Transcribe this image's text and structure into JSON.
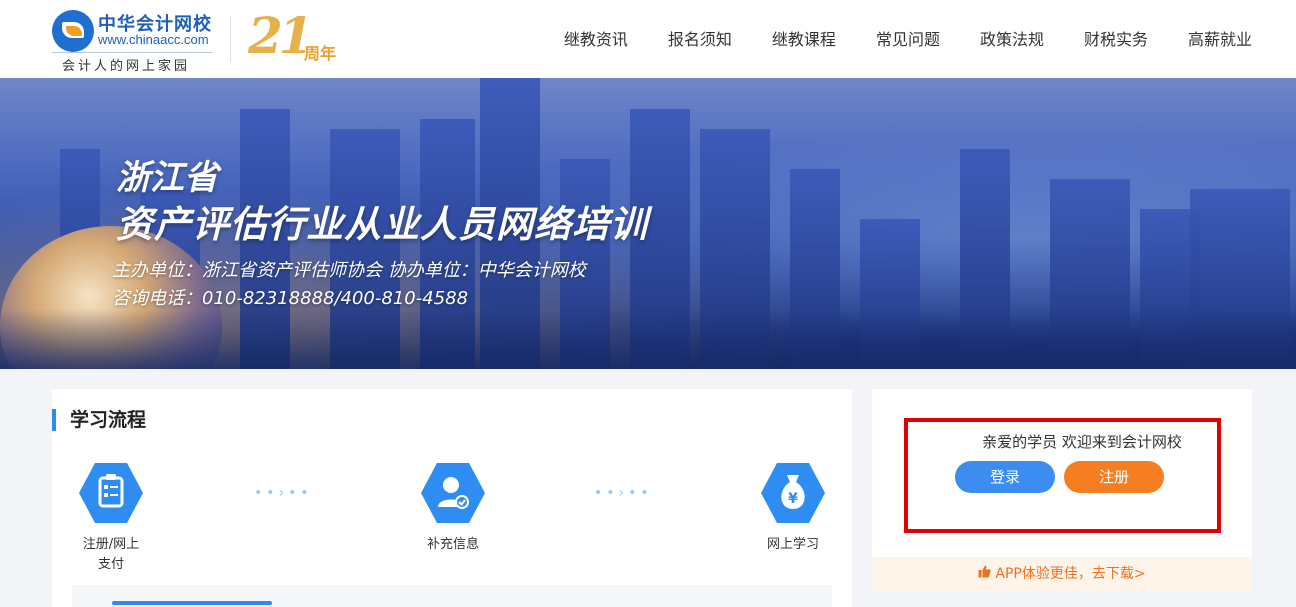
{
  "header": {
    "logo_cn": "中华会计网校",
    "logo_en": "www.chinaacc.com",
    "logo_slogan": "会计人的网上家园",
    "anniversary_number": "21",
    "anniversary_text": "周年",
    "nav": [
      "继教资讯",
      "报名须知",
      "继教课程",
      "常见问题",
      "政策法规",
      "财税实务",
      "高薪就业"
    ]
  },
  "banner": {
    "title_line1": "浙江省",
    "title_line2": "资产评估行业从业人员网络培训",
    "sub_line1": "主办单位：浙江省资产评估师协会   协办单位：中华会计网校",
    "sub_line2": "咨询电话：010-82318888/400-810-4588"
  },
  "process": {
    "title": "学习流程",
    "steps": [
      {
        "label": "注册/网上\n支付",
        "icon": "clipboard-icon"
      },
      {
        "label": "补充信息",
        "icon": "user-check-icon"
      },
      {
        "label": "网上学习",
        "icon": "money-bag-icon"
      }
    ],
    "arrow_glyph": "••›••"
  },
  "login": {
    "welcome": "亲爱的学员 欢迎来到会计网校",
    "login_label": "登录",
    "register_label": "注册",
    "app_text": "APP体验更佳，去下载>"
  },
  "colors": {
    "primary_blue": "#2f8df2",
    "orange": "#f57e22",
    "highlight_red": "#e30000"
  }
}
